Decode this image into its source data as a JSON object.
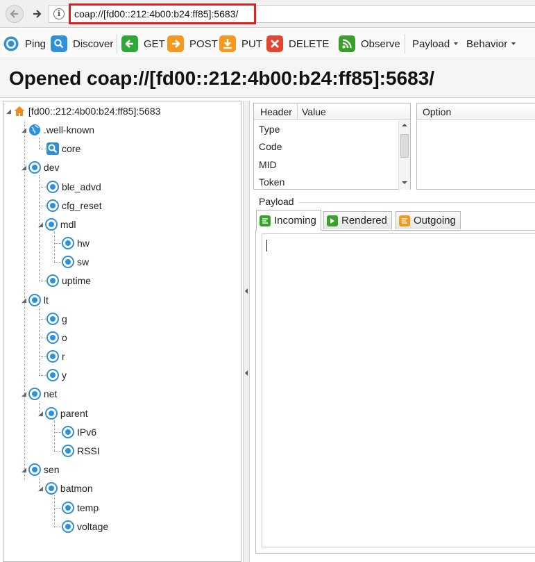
{
  "browser": {
    "url": "coap://[fd00::212:4b00:b24:ff85]:5683/",
    "info_glyph": "i"
  },
  "toolbar": {
    "ping": "Ping",
    "discover": "Discover",
    "get": "GET",
    "post": "POST",
    "put": "PUT",
    "delete": "DELETE",
    "observe": "Observe",
    "payload": "Payload",
    "behavior": "Behavior"
  },
  "title": "Opened coap://[fd00::212:4b00:b24:ff85]:5683/",
  "tree": {
    "root": "[fd00::212:4b00:b24:ff85]:5683",
    "nodes": [
      "[fd00::212:4b00:b24:ff85]:5683",
      ".well-known",
      "core",
      "dev",
      "ble_advd",
      "cfg_reset",
      "mdl",
      "hw",
      "sw",
      "uptime",
      "lt",
      "g",
      "o",
      "r",
      "y",
      "net",
      "parent",
      "IPv6",
      "RSSI",
      "sen",
      "batmon",
      "temp",
      "voltage"
    ]
  },
  "header_grid": {
    "columns": [
      "Header",
      "Value"
    ],
    "rows": [
      "Type",
      "Code",
      "MID",
      "Token"
    ]
  },
  "option_grid": {
    "columns": [
      "Option"
    ]
  },
  "payload": {
    "label": "Payload",
    "tabs": [
      "Incoming",
      "Rendered",
      "Outgoing"
    ]
  },
  "colors": {
    "accent_blue": "#2f8fd8",
    "highlight_red": "#e0201f",
    "get_green": "#2fa83a",
    "post_orange": "#f29a1f",
    "delete_red": "#e5452f",
    "observe_green": "#3aa02c"
  }
}
